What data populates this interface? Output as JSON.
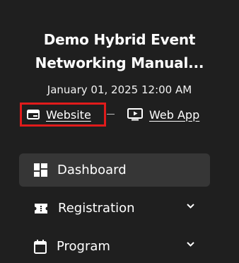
{
  "event": {
    "title_line1": "Demo Hybrid Event",
    "title_line2": "Networking Manual...",
    "date": "January 01, 2025 12:00 AM"
  },
  "links": {
    "website": {
      "label": "Website",
      "icon": "browser-window-icon"
    },
    "separator": "–",
    "webapp": {
      "label": "Web App",
      "icon": "monitor-play-icon"
    }
  },
  "nav": {
    "items": [
      {
        "label": "Dashboard",
        "icon": "dashboard-grid-icon",
        "active": true,
        "expandable": false
      },
      {
        "label": "Registration",
        "icon": "ticket-icon",
        "active": false,
        "expandable": true
      },
      {
        "label": "Program",
        "icon": "calendar-icon",
        "active": false,
        "expandable": true
      }
    ]
  },
  "colors": {
    "background": "#1f1f1f",
    "active_item": "#363636",
    "highlight_box": "#e01b1b",
    "text": "#ffffff"
  }
}
